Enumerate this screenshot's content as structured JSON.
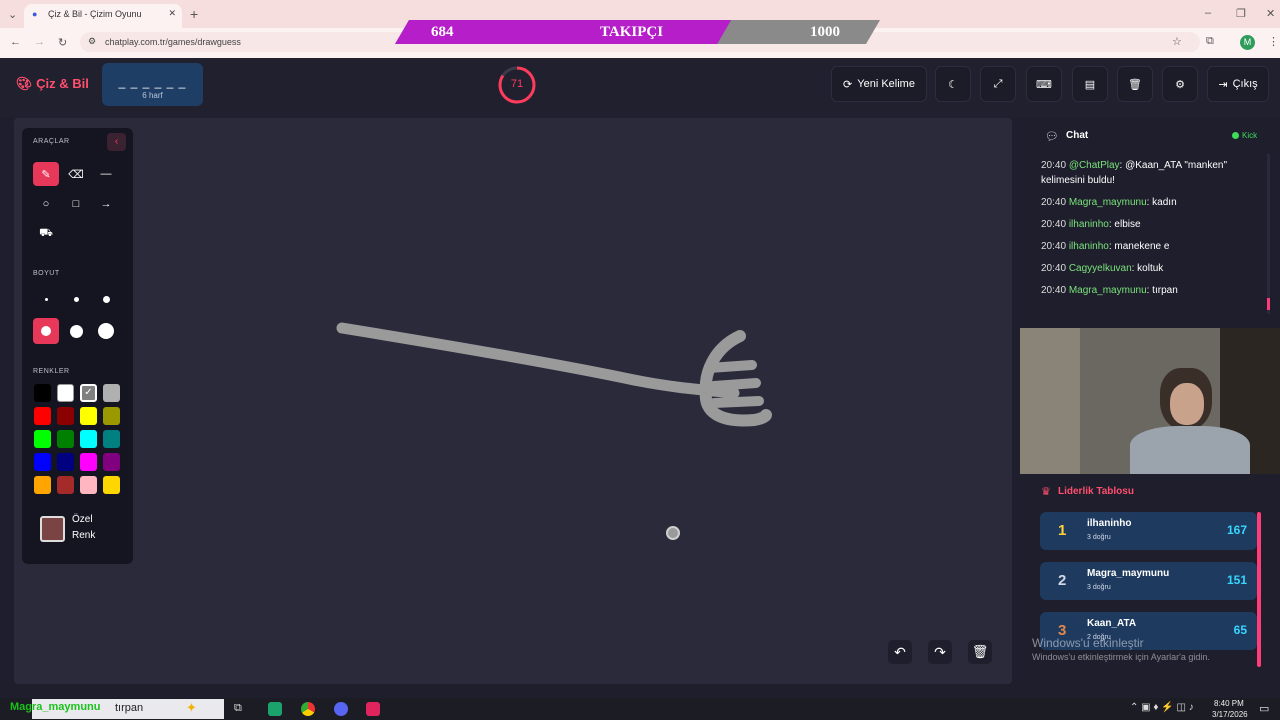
{
  "browser": {
    "tab_title": "Çiz & Bil - Çizim Oyunu",
    "url": "chatplay.com.tr/games/drawguess",
    "profile_initial": "M"
  },
  "banner": {
    "current": "684",
    "label": "TAKIPÇI",
    "goal": "1000",
    "progress": 0.684
  },
  "header": {
    "logo": "Çiz & Bil",
    "word_mask": "_ _ _ _ _ _",
    "word_hint": "6 harf",
    "timer": "71",
    "new_word": "Yeni Kelime",
    "logout": "Çıkış"
  },
  "tools": {
    "title": "ARAÇLAR",
    "size_title": "BOYUT",
    "colors_title": "RENKLER",
    "custom_color_line1": "Özel",
    "custom_color_line2": "Renk",
    "custom_color": "#7a4444",
    "palette": [
      "#000000",
      "#ffffff",
      "#808080",
      "#b0b0b0",
      "#ff0000",
      "#8b0000",
      "#ffff00",
      "#9a9a00",
      "#00ff00",
      "#008000",
      "#00ffff",
      "#008080",
      "#0000ff",
      "#000080",
      "#ff00ff",
      "#800080",
      "#ffa500",
      "#a52a2a",
      "#ffb6c1",
      "#ffd700"
    ]
  },
  "chat": {
    "title": "Chat",
    "status": "Kick",
    "messages": [
      {
        "time": "20:40",
        "user": "@ChatPlay",
        "text": ": @Kaan_ATA \"manken\" kelimesini buldu!"
      },
      {
        "time": "20:40",
        "user": "Magra_maymunu",
        "text": ": kadın"
      },
      {
        "time": "20:40",
        "user": "ilhaninho",
        "text": ": elbise"
      },
      {
        "time": "20:40",
        "user": "ilhaninho",
        "text": ": manekene e"
      },
      {
        "time": "20:40",
        "user": "Cagyyelkuvan",
        "text": ": koltuk"
      },
      {
        "time": "20:40",
        "user": "Magra_maymunu",
        "text": ": tırpan"
      }
    ]
  },
  "leaderboard": {
    "title": "Liderlik Tablosu",
    "rows": [
      {
        "rank": "1",
        "name": "ilhaninho",
        "sub": "3 doğru",
        "points": "167",
        "rank_color": "#ffd23a"
      },
      {
        "rank": "2",
        "name": "Magra_maymunu",
        "sub": "3 doğru",
        "points": "151",
        "rank_color": "#cfd8e6"
      },
      {
        "rank": "3",
        "name": "Kaan_ATA",
        "sub": "2 doğru",
        "points": "65",
        "rank_color": "#e0884a"
      }
    ]
  },
  "watermark": {
    "line1": "Windows'u etkinleştir",
    "line2": "Windows'u etkinleştirmek için Ayarlar'a gidin."
  },
  "overlay": {
    "user": "Magra_maymunu",
    "text": "tırpan"
  },
  "taskbar": {
    "time": "8:40 PM",
    "date": "3/17/2026"
  }
}
